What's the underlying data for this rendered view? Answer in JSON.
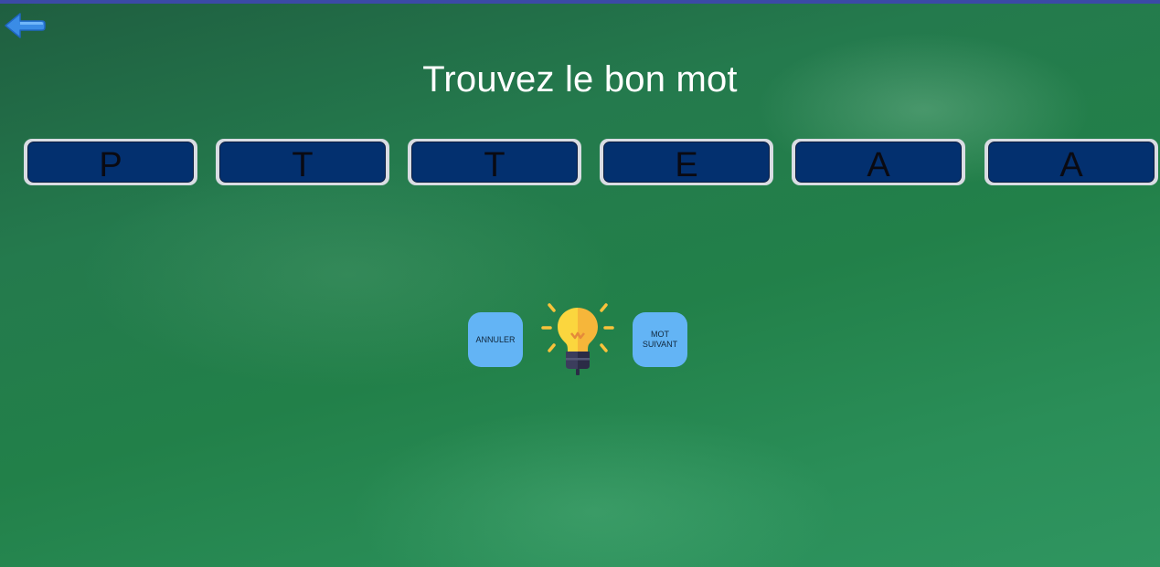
{
  "header": {
    "back_icon": "arrow-left-icon",
    "title": "Trouvez le bon mot"
  },
  "letters": [
    "P",
    "T",
    "T",
    "E",
    "A",
    "A"
  ],
  "controls": {
    "cancel_label": "ANNULER",
    "next_label": "MOT\nSUIVANT",
    "hint_icon": "lightbulb-icon"
  },
  "colors": {
    "accent_strip": "#3b4aa6",
    "tile_fill": "#03306f",
    "tile_border": "#d9dce3",
    "button_fill": "#63b4f5",
    "back_arrow": "#3d8fe6",
    "bulb": "#f9c93b"
  }
}
